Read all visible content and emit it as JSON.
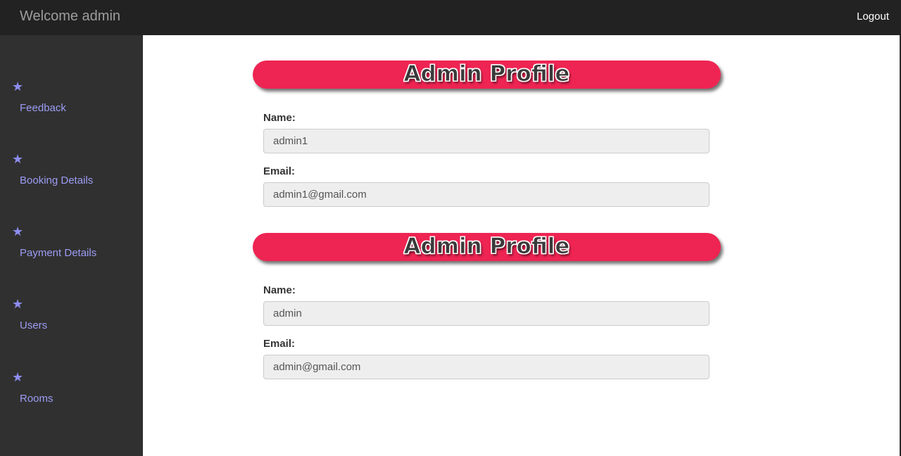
{
  "header": {
    "brand": "Welcome admin",
    "logout_label": "Logout"
  },
  "sidebar": {
    "items": [
      {
        "icon": "star-icon",
        "label": "Feedback"
      },
      {
        "icon": "star-icon",
        "label": "Booking Details"
      },
      {
        "icon": "star-icon",
        "label": "Payment Details"
      },
      {
        "icon": "star-icon",
        "label": "Users"
      },
      {
        "icon": "star-icon",
        "label": "Rooms"
      }
    ],
    "star_glyph": "★"
  },
  "profiles": [
    {
      "title": "Admin Profile",
      "name_label": "Name:",
      "name_value": "admin1",
      "email_label": "Email:",
      "email_value": "admin1@gmail.com"
    },
    {
      "title": "Admin Profile",
      "name_label": "Name:",
      "name_value": "admin",
      "email_label": "Email:",
      "email_value": "admin@gmail.com"
    }
  ],
  "colors": {
    "topbar": "#222222",
    "sidebar": "#303030",
    "nav_text": "#9c9cf5",
    "banner": "#ee2452"
  }
}
